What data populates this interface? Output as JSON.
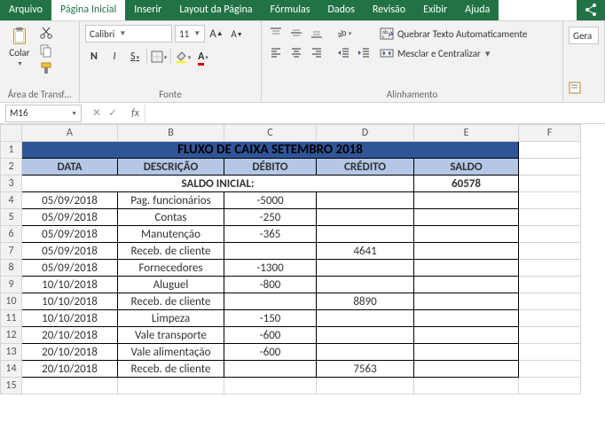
{
  "tabs": {
    "file": "Arquivo",
    "home": "Página Inicial",
    "insert": "Inserir",
    "layout": "Layout da Página",
    "formulas": "Fórmulas",
    "data": "Dados",
    "review": "Revisão",
    "view": "Exibir",
    "help": "Ajuda"
  },
  "ribbon": {
    "clipboard": {
      "label": "Área de Transf…",
      "paste": "Colar"
    },
    "font": {
      "label": "Fonte",
      "name": "Calibri",
      "size": "11",
      "bold": "N",
      "italic": "I",
      "underline": "S"
    },
    "align": {
      "label": "Alinhamento",
      "wrap": "Quebrar Texto Automaticamente",
      "merge": "Mesclar e Centralizar"
    },
    "general": "Gera"
  },
  "namebox": "M16",
  "fx": "fx",
  "cols": [
    "A",
    "B",
    "C",
    "D",
    "E",
    "F"
  ],
  "title": "FLUXO DE CAIXA SETEMBRO 2018",
  "headers": {
    "a": "DATA",
    "b": "DESCRIÇÃO",
    "c": "DÉBITO",
    "d": "CRÉDITO",
    "e": "SALDO"
  },
  "saldo_inicial_label": "SALDO INICIAL:",
  "saldo_inicial_value": "60578",
  "rows": [
    {
      "n": "4",
      "a": "05/09/2018",
      "b": "Pag. funcionários",
      "c": "-5000",
      "d": "",
      "e": ""
    },
    {
      "n": "5",
      "a": "05/09/2018",
      "b": "Contas",
      "c": "-250",
      "d": "",
      "e": ""
    },
    {
      "n": "6",
      "a": "05/09/2018",
      "b": "Manutenção",
      "c": "-365",
      "d": "",
      "e": ""
    },
    {
      "n": "7",
      "a": "05/09/2018",
      "b": "Receb. de cliente",
      "c": "",
      "d": "4641",
      "e": ""
    },
    {
      "n": "8",
      "a": "05/09/2018",
      "b": "Fornecedores",
      "c": "-1300",
      "d": "",
      "e": ""
    },
    {
      "n": "9",
      "a": "10/10/2018",
      "b": "Aluguel",
      "c": "-800",
      "d": "",
      "e": ""
    },
    {
      "n": "10",
      "a": "10/10/2018",
      "b": "Receb. de cliente",
      "c": "",
      "d": "8890",
      "e": ""
    },
    {
      "n": "11",
      "a": "10/10/2018",
      "b": "Limpeza",
      "c": "-150",
      "d": "",
      "e": ""
    },
    {
      "n": "12",
      "a": "20/10/2018",
      "b": "Vale transporte",
      "c": "-600",
      "d": "",
      "e": ""
    },
    {
      "n": "13",
      "a": "20/10/2018",
      "b": "Vale alimentação",
      "c": "-600",
      "d": "",
      "e": ""
    },
    {
      "n": "14",
      "a": "20/10/2018",
      "b": "Receb. de cliente",
      "c": "",
      "d": "7563",
      "e": ""
    }
  ],
  "empty_row": "15"
}
